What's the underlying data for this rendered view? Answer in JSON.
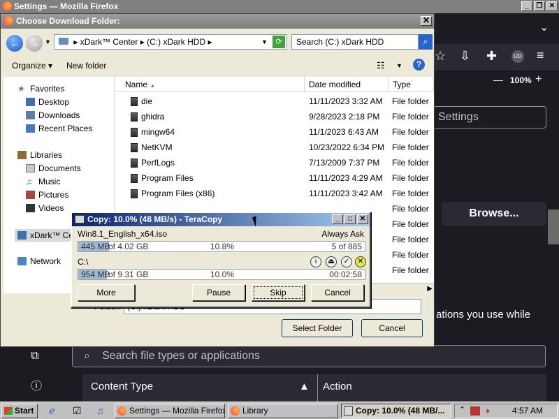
{
  "firefox": {
    "title": "Settings — Mozilla Firefox",
    "zoom": "100%",
    "zoom_minus": "—",
    "zoom_plus": "+",
    "settings_search_placeholder": "Settings",
    "browse_label": "Browse...",
    "apps_text": "ations you use while",
    "file_types_placeholder": "Search file types or applications",
    "content_type_header": "Content Type",
    "action_header": "Action"
  },
  "dialog": {
    "title": "Choose Download Folder:",
    "address": {
      "seg1": "xDark™ Center",
      "seg2": "(C:) xDark HDD",
      "sep": "▸"
    },
    "search_placeholder": "Search (C:) xDark HDD",
    "organize_label": "Organize ▾",
    "new_folder_label": "New folder",
    "nav": {
      "favorites": "Favorites",
      "desktop": "Desktop",
      "downloads": "Downloads",
      "recent_places": "Recent Places",
      "libraries": "Libraries",
      "documents": "Documents",
      "music": "Music",
      "pictures": "Pictures",
      "videos": "Videos",
      "computer": "xDark™ Center",
      "network": "Network"
    },
    "columns": [
      "Name",
      "Date modified",
      "Type"
    ],
    "rows": [
      {
        "name": "die",
        "date": "11/11/2023 3:32 AM",
        "type": "File folder"
      },
      {
        "name": "ghidra",
        "date": "9/28/2023 2:18 PM",
        "type": "File folder"
      },
      {
        "name": "mingw64",
        "date": "11/1/2023 6:43 AM",
        "type": "File folder"
      },
      {
        "name": "NetKVM",
        "date": "10/23/2022 6:34 PM",
        "type": "File folder"
      },
      {
        "name": "PerfLogs",
        "date": "7/13/2009 7:37 PM",
        "type": "File folder"
      },
      {
        "name": "Program Files",
        "date": "11/11/2023 4:29 AM",
        "type": "File folder"
      },
      {
        "name": "Program Files (x86)",
        "date": "11/11/2023 3:42 AM",
        "type": "File folder"
      },
      {
        "name": "",
        "date": "",
        "type": "File folder"
      },
      {
        "name": "",
        "date": "",
        "type": "File folder"
      },
      {
        "name": "",
        "date": "",
        "type": "File folder"
      },
      {
        "name": "",
        "date": "",
        "type": "File folder"
      },
      {
        "name": "",
        "date": "",
        "type": "File folder"
      }
    ],
    "folder_label": "Folder:",
    "folder_value": "(C:) xDark HDD",
    "select_folder_label": "Select Folder",
    "cancel_label": "Cancel"
  },
  "teracopy": {
    "title": "Copy: 10.0% (48 MB/s) - TeraCopy",
    "file_name": "Win8.1_English_x64.iso",
    "mode": "Always Ask",
    "file_progress": {
      "done": "445 MB",
      "of": "of 4.02 GB",
      "percent": "10.8%",
      "count": "5 of 885",
      "fraction": 0.108
    },
    "dest": "C:\\",
    "total_progress": {
      "done": "954 MB",
      "of": "of 9.31 GB",
      "percent": "10.0%",
      "time": "00:02:58",
      "fraction": 0.1
    },
    "more_label": "More",
    "pause_label": "Pause",
    "skip_label": "Skip",
    "cancel_label": "Cancel"
  },
  "taskbar": {
    "start_label": "Start",
    "tasks": [
      "Settings — Mozilla Firefox",
      "Library",
      "Copy: 10.0% (48 MB/..."
    ],
    "clock": "4:57 AM"
  }
}
